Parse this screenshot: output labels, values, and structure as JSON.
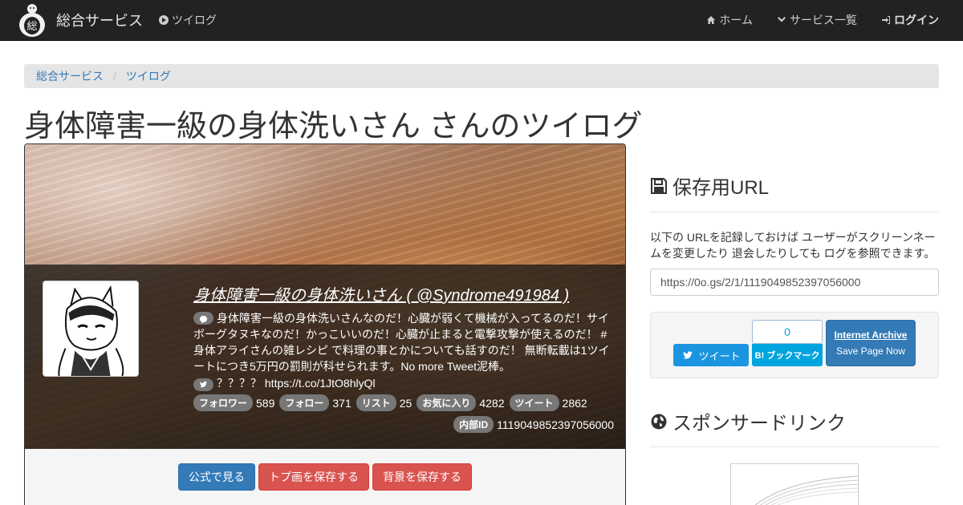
{
  "navbar": {
    "brand": "総合サービス",
    "section": "ツイログ",
    "home": "ホーム",
    "services": "サービス一覧",
    "login": "ログイン"
  },
  "breadcrumb": [
    "総合サービス",
    "ツイログ"
  ],
  "page_title": "身体障害一級の身体洗いさん さんのツイログ",
  "profile": {
    "name_link": "身体障害一級の身体洗いさん ( @Syndrome491984 )",
    "bio": "身体障害一級の身体洗いさんなのだ！心臓が弱くて機械が入ってるのだ！サイボーグタヌキなのだ！かっこいいのだ！心臓が止まると電撃攻撃が使えるのだ！ #身体アライさんの雑レシピ で料理の事とかについても話すのだ！ 無断転載は1ツイートにつき5万円の罰則が科せられます。No more Tweet泥棒。",
    "location": "？？？？",
    "url": "https://t.co/1JtO8hlyQl",
    "stats": [
      {
        "label": "フォロワー",
        "value": "589"
      },
      {
        "label": "フォロー",
        "value": "371"
      },
      {
        "label": "リスト",
        "value": "25"
      },
      {
        "label": "お気に入り",
        "value": "4282"
      },
      {
        "label": "ツイート",
        "value": "2862"
      }
    ],
    "internal_id_label": "内部ID",
    "internal_id": "1119049852397056000"
  },
  "actions": {
    "official": "公式で見る",
    "save_avatar": "トプ画を保存する",
    "save_banner": "背景を保存する"
  },
  "sidebar": {
    "save_title": "保存用URL",
    "save_text": "以下の URLを記録しておけば ユーザーがスクリーンネームを変更したり 退会したりしても ログを参照できます。",
    "save_url": "https://0o.gs/2/1/1119049852397056000",
    "tweet_label": "ツイート",
    "hatena_count": "0",
    "hatena_label": "B! ブックマーク",
    "ia_title": "Internet Archive",
    "ia_sub": "Save Page Now",
    "sponsor_title": "スポンサードリンク"
  },
  "colors": {
    "navbar": "#222222",
    "link": "#337ab7",
    "primary": "#337ab7",
    "danger": "#d9534f",
    "twitter": "#1b95e0",
    "hatena": "#00a4de"
  }
}
